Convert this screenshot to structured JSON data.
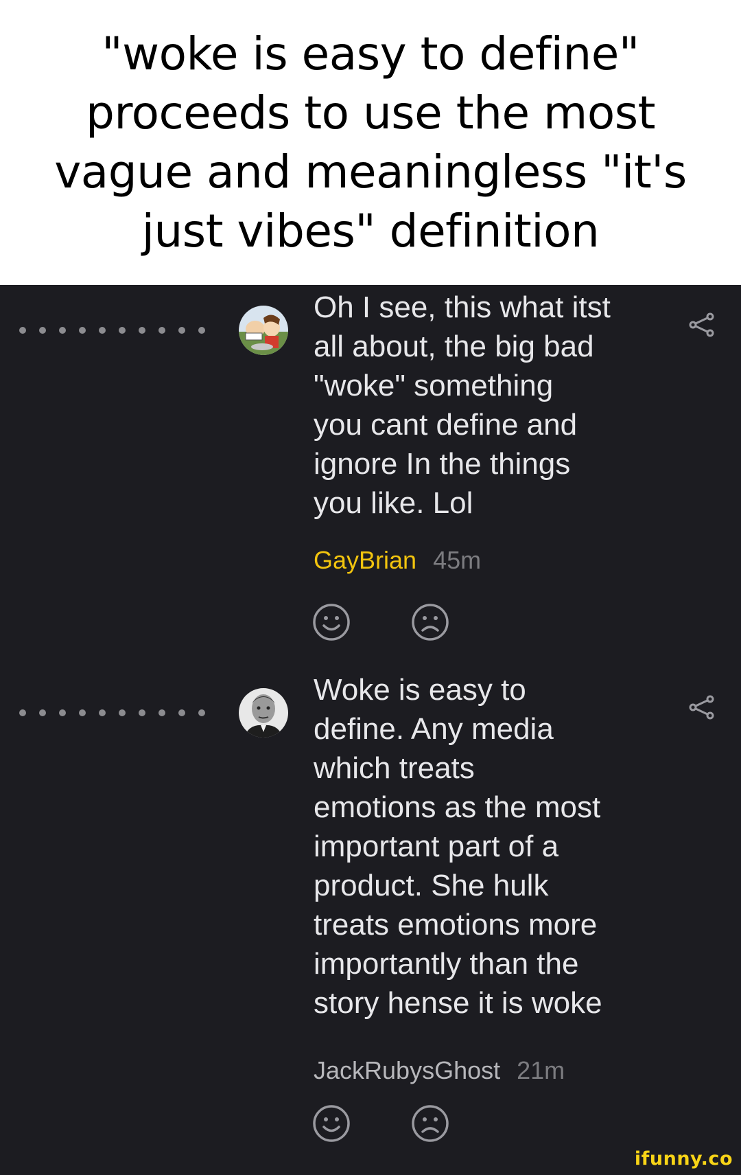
{
  "caption": {
    "text": "\"woke is easy to define\"\nproceeds to use the most\nvague and meaningless \"it's\njust vibes\" definition"
  },
  "comments": [
    {
      "text": "Oh I see, this what itst\nall about, the big bad\n\"woke\" something\nyou cant define and\nignore In the things\nyou like. Lol",
      "author": "GayBrian",
      "author_color": "#f2c40e",
      "time": "45m",
      "avatar_icon": "cartoon-avatar-icon"
    },
    {
      "text": "Woke is easy to\ndefine. Any media\nwhich treats\nemotions as the most\nimportant part of a\nproduct. She hulk\ntreats emotions more\nimportantly than the\nstory hense it is woke",
      "author": "JackRubysGhost",
      "author_color": "#b7b7bb",
      "time": "21m",
      "avatar_icon": "portrait-avatar-icon"
    }
  ],
  "icons": {
    "share": "share-icon",
    "smile": "smile-icon",
    "frown": "frown-icon"
  },
  "watermark": {
    "text": "ifunny.co"
  },
  "colors": {
    "background": "#1c1c21",
    "text": "#e7e7ea",
    "accent": "#f8d417"
  }
}
